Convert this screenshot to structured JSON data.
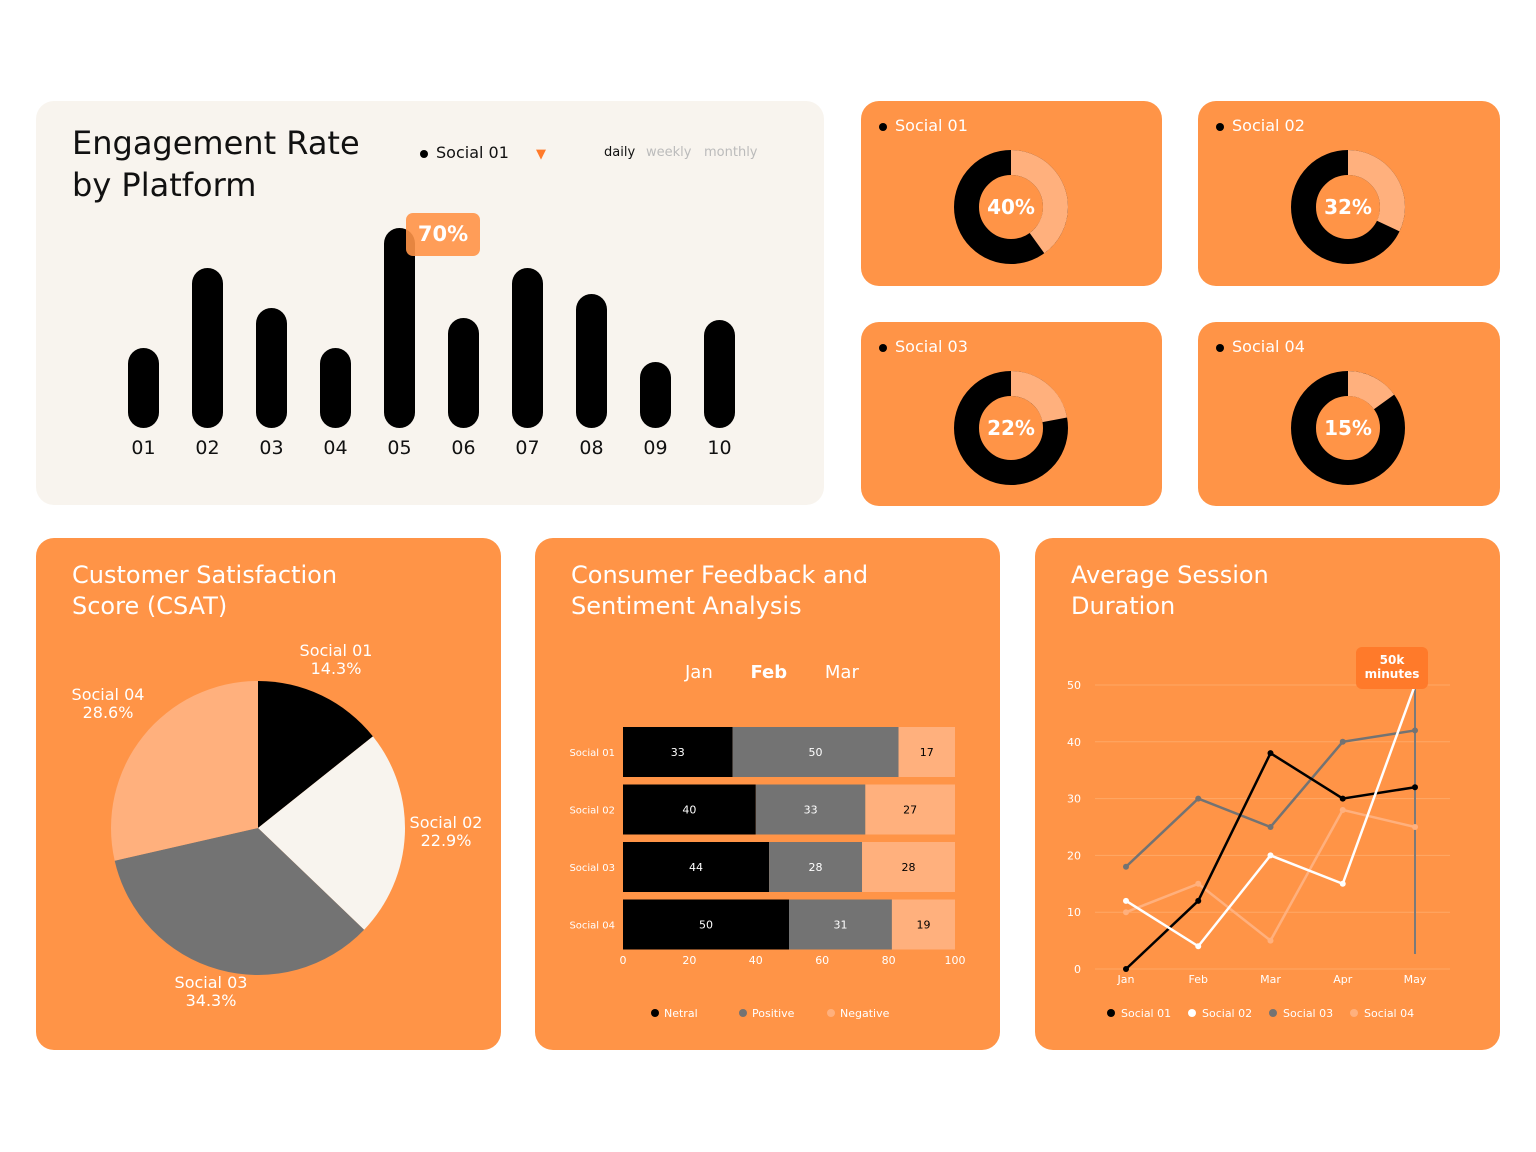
{
  "engagement": {
    "title": "Engagement Rate\nby Platform",
    "series_selector": "Social 01",
    "periods": [
      "daily",
      "weekly",
      "monthly"
    ],
    "active_period": "daily",
    "highlight_label": "70%"
  },
  "donuts": [
    {
      "label": "Social 01",
      "value_label": "40%"
    },
    {
      "label": "Social 02",
      "value_label": "32%"
    },
    {
      "label": "Social 03",
      "value_label": "22%"
    },
    {
      "label": "Social 04",
      "value_label": "15%"
    }
  ],
  "csat": {
    "title": "Customer Satisfaction\nScore (CSAT)"
  },
  "feedback": {
    "title": "Consumer Feedback and\nSentiment Analysis",
    "months": [
      "Jan",
      "Feb",
      "Mar"
    ],
    "active_month": "Feb"
  },
  "session": {
    "title": "Average Session\nDuration",
    "callout": "50k\nminutes"
  },
  "colors": {
    "orange": "#ff9447",
    "black": "#000000",
    "gray": "#737373",
    "peach": "#ffb07d",
    "cream": "#f8f4ee",
    "white": "#ffffff"
  },
  "chart_data": [
    {
      "id": "engagement",
      "type": "bar",
      "categories": [
        "01",
        "02",
        "03",
        "04",
        "05",
        "06",
        "07",
        "08",
        "09",
        "10"
      ],
      "values": [
        40,
        80,
        60,
        40,
        100,
        55,
        80,
        67,
        33,
        54
      ],
      "highlight_index": 4
    },
    {
      "id": "donuts",
      "type": "pie",
      "categories": [
        "Social 01",
        "Social 02",
        "Social 03",
        "Social 04"
      ],
      "values": [
        40,
        32,
        22,
        15
      ]
    },
    {
      "id": "csat",
      "type": "pie",
      "categories": [
        "Social 01",
        "Social 02",
        "Social 03",
        "Social 04"
      ],
      "values": [
        14.3,
        22.9,
        34.3,
        28.6
      ],
      "value_labels": [
        "14.3%",
        "22.9%",
        "34.3%",
        "28.6%"
      ],
      "colors": [
        "#000000",
        "#f8f4ee",
        "#737373",
        "#ffb07d"
      ]
    },
    {
      "id": "feedback",
      "type": "bar",
      "orientation": "horizontal-stacked",
      "categories": [
        "Social 01",
        "Social 02",
        "Social 03",
        "Social 04"
      ],
      "series": [
        {
          "name": "Netral",
          "values": [
            33,
            40,
            44,
            50
          ],
          "color": "#000000"
        },
        {
          "name": "Positive",
          "values": [
            50,
            33,
            28,
            31
          ],
          "color": "#737373"
        },
        {
          "name": "Negative",
          "values": [
            17,
            27,
            28,
            19
          ],
          "color": "#ffb07d"
        }
      ],
      "xlim": [
        0,
        100
      ],
      "xticks": [
        0,
        20,
        40,
        60,
        80,
        100
      ]
    },
    {
      "id": "session",
      "type": "line",
      "categories": [
        "Jan",
        "Feb",
        "Mar",
        "Apr",
        "May"
      ],
      "series": [
        {
          "name": "Social 01",
          "values": [
            0,
            12,
            38,
            30,
            32
          ],
          "color": "#000000"
        },
        {
          "name": "Social 02",
          "values": [
            12,
            4,
            20,
            15,
            50
          ],
          "color": "#ffffff"
        },
        {
          "name": "Social 03",
          "values": [
            18,
            30,
            25,
            40,
            42
          ],
          "color": "#737373"
        },
        {
          "name": "Social 04",
          "values": [
            10,
            15,
            5,
            28,
            25
          ],
          "color": "#ffb07d"
        }
      ],
      "ylim": [
        0,
        50
      ],
      "yticks": [
        0,
        10,
        20,
        30,
        40,
        50
      ],
      "grid": true
    }
  ]
}
